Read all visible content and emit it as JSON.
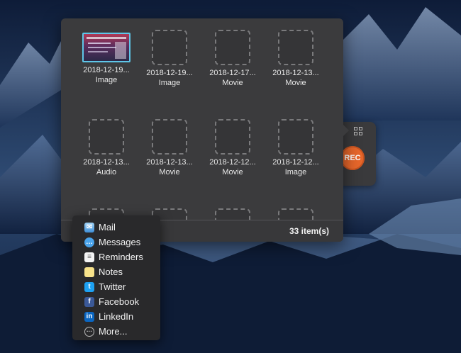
{
  "recorder": {
    "rec_label": "REC",
    "grid_icon": "grid-icon",
    "accent_color": "#e8672b"
  },
  "gallery": {
    "items": [
      {
        "date": "2018-12-19...",
        "type": "Image",
        "thumbnail": "screenshot-preview",
        "selected": true
      },
      {
        "date": "2018-12-19...",
        "type": "Image",
        "thumbnail": "placeholder"
      },
      {
        "date": "2018-12-17...",
        "type": "Movie",
        "thumbnail": "placeholder"
      },
      {
        "date": "2018-12-13...",
        "type": "Movie",
        "thumbnail": "placeholder"
      },
      {
        "date": "2018-12-13...",
        "type": "Audio",
        "thumbnail": "placeholder"
      },
      {
        "date": "2018-12-13...",
        "type": "Movie",
        "thumbnail": "placeholder"
      },
      {
        "date": "2018-12-12...",
        "type": "Movie",
        "thumbnail": "placeholder"
      },
      {
        "date": "2018-12-12...",
        "type": "Image",
        "thumbnail": "placeholder"
      },
      {
        "date": "",
        "type": "",
        "thumbnail": "placeholder"
      },
      {
        "date": "",
        "type": "",
        "thumbnail": "placeholder"
      },
      {
        "date": "",
        "type": "",
        "thumbnail": "placeholder"
      },
      {
        "date": "",
        "type": "",
        "thumbnail": "placeholder"
      }
    ],
    "item_count": "33 item(s)",
    "selection_color": "#5ec6e8"
  },
  "share_menu": {
    "items": [
      {
        "label": "Mail",
        "icon": "mail-icon"
      },
      {
        "label": "Messages",
        "icon": "messages-icon"
      },
      {
        "label": "Reminders",
        "icon": "reminders-icon"
      },
      {
        "label": "Notes",
        "icon": "notes-icon"
      },
      {
        "label": "Twitter",
        "icon": "twitter-icon"
      },
      {
        "label": "Facebook",
        "icon": "facebook-icon"
      },
      {
        "label": "LinkedIn",
        "icon": "linkedin-icon"
      },
      {
        "label": "More...",
        "icon": "more-icon"
      }
    ]
  }
}
